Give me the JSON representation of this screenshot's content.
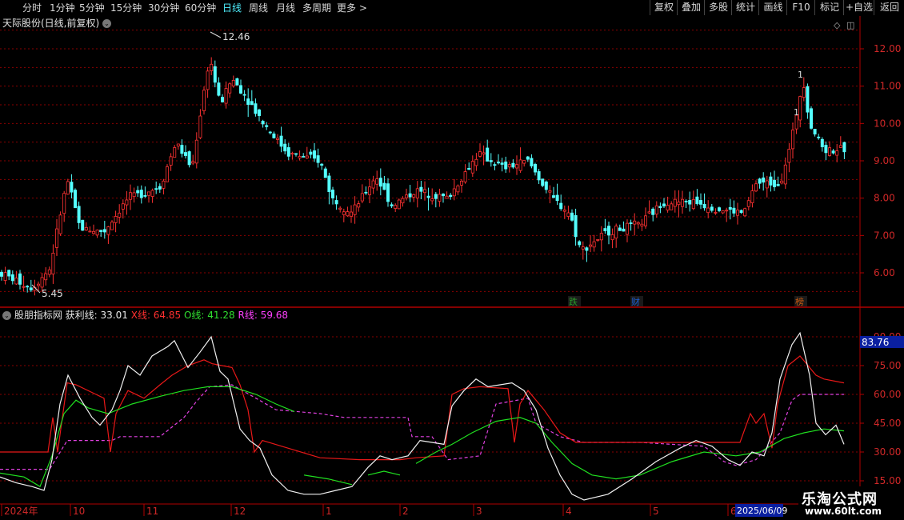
{
  "toolbar": {
    "periods": [
      "分时",
      "1分钟",
      "5分钟",
      "15分钟",
      "30分钟",
      "60分钟",
      "日线",
      "周线",
      "月线",
      "多周期",
      "更多 >"
    ],
    "active_period": "日线",
    "right_buttons": [
      "复权",
      "叠加",
      "多股",
      "统计",
      "画线",
      "F10",
      "标记",
      "+自选",
      "返回"
    ]
  },
  "main_panel": {
    "title": "天际股份(日线,前复权)",
    "price_ticks": [
      "12.00",
      "11.00",
      "10.00",
      "9.00",
      "8.00",
      "7.00",
      "6.00"
    ],
    "high_label": "12.46",
    "low_label": "5.45",
    "event_badges": [
      {
        "label": "跌",
        "color": "#2a9a2a"
      },
      {
        "label": "财",
        "color": "#1e5fd0"
      },
      {
        "label": "榜",
        "color": "#c85a10"
      }
    ],
    "peak_marks": [
      "1",
      "1"
    ]
  },
  "indicator_panel": {
    "name": "股朋指标网",
    "items": [
      {
        "label": "获利线: 33.01",
        "color": "#e8e8e8"
      },
      {
        "label": "X线: 64.85",
        "color": "#ff3030"
      },
      {
        "label": "O线: 41.28",
        "color": "#30e030"
      },
      {
        "label": "R线: 59.68",
        "color": "#ff40ff"
      }
    ],
    "ticks": [
      "90.00",
      "75.00",
      "60.00",
      "45.00",
      "30.00",
      "15.00"
    ],
    "current_value": "83.76",
    "colors": {
      "white": "#f0f0f0",
      "red": "#e81818",
      "green": "#20e020",
      "magenta": "#e040e0"
    }
  },
  "date_axis": {
    "labels": [
      "2024年",
      "10",
      "11",
      "12",
      "1",
      "2",
      "3",
      "4",
      "5",
      "6"
    ],
    "current_date": "2025/06/09"
  },
  "watermark": {
    "name": "乐淘公式网",
    "url": "www.60lt.com"
  },
  "colors": {
    "up": "#ff3232",
    "down": "#54ffff",
    "grid": "#8a0000",
    "axis": "#b00000",
    "label": "#d02828"
  }
}
